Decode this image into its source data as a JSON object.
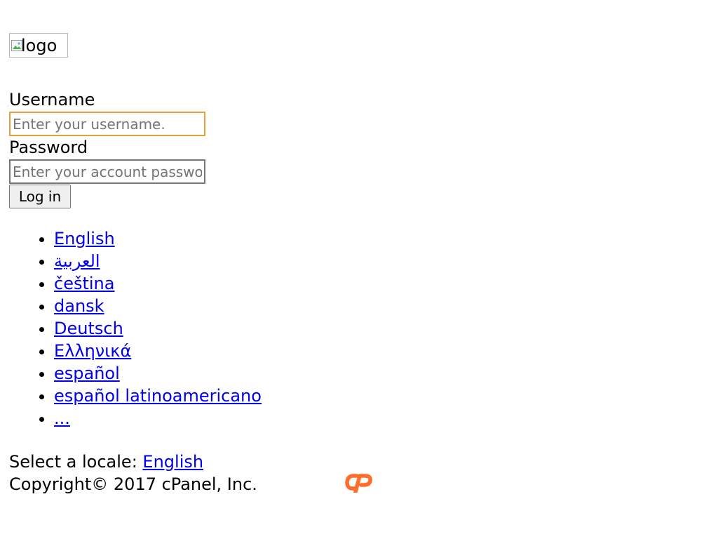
{
  "logo": {
    "alt_text": "logo"
  },
  "login_form": {
    "username_label": "Username",
    "username_placeholder": "Enter your username.",
    "username_value": "",
    "password_label": "Password",
    "password_placeholder": "Enter your account password.",
    "password_value": "",
    "login_button_label": "Log in"
  },
  "languages": [
    "English",
    "العربية",
    "čeština",
    "dansk",
    "Deutsch",
    "Ελληνικά",
    "español",
    "español latinoamericano",
    "..."
  ],
  "locale": {
    "prefix": "Select a locale:",
    "current": "English"
  },
  "footer": {
    "copyright": "Copyright© 2017 cPanel, Inc.",
    "brand_icon": "cpanel-logo-icon",
    "brand_color": "#ff6c2c"
  },
  "colors": {
    "link": "#0000ee",
    "focus_border": "#e5a139"
  }
}
